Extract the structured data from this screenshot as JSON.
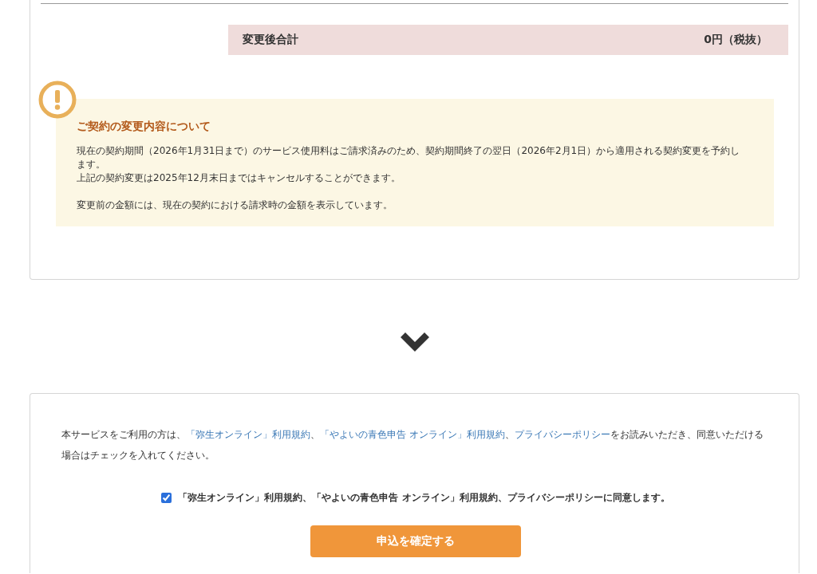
{
  "summary": {
    "label": "変更後合計",
    "value": "0円（税抜）"
  },
  "notice": {
    "title": "ご契約の変更内容について",
    "paragraphs": [
      [
        "現在の契約期間（2026年1月31日まで）のサービス使用料はご請求済みのため、契約期間終了の翌日（2026年2月1日）から適用される契約変更を予約します。",
        "上記の契約変更は2025年12月末日まではキャンセルすることができます。"
      ],
      [
        "変更前の金額には、現在の契約における請求時の金額を表示しています。"
      ]
    ]
  },
  "agreement": {
    "intro": [
      {
        "kind": "text",
        "text": "本サービスをご利用の方は、"
      },
      {
        "kind": "link",
        "text": "「弥生オンライン」利用規約"
      },
      {
        "kind": "text",
        "text": "、"
      },
      {
        "kind": "link",
        "text": "「やよいの青色申告 オンライン」利用規約"
      },
      {
        "kind": "text",
        "text": "、"
      },
      {
        "kind": "link",
        "text": "プライバシーポリシー"
      },
      {
        "kind": "text",
        "text": "をお読みいただき、同意いただける場合はチェックを入れてください。"
      }
    ],
    "checkbox": {
      "label": "「弥生オンライン」利用規約、「やよいの青色申告 オンライン」利用規約、プライバシーポリシーに同意します。",
      "checked": true
    },
    "submit": "申込を確定する"
  }
}
